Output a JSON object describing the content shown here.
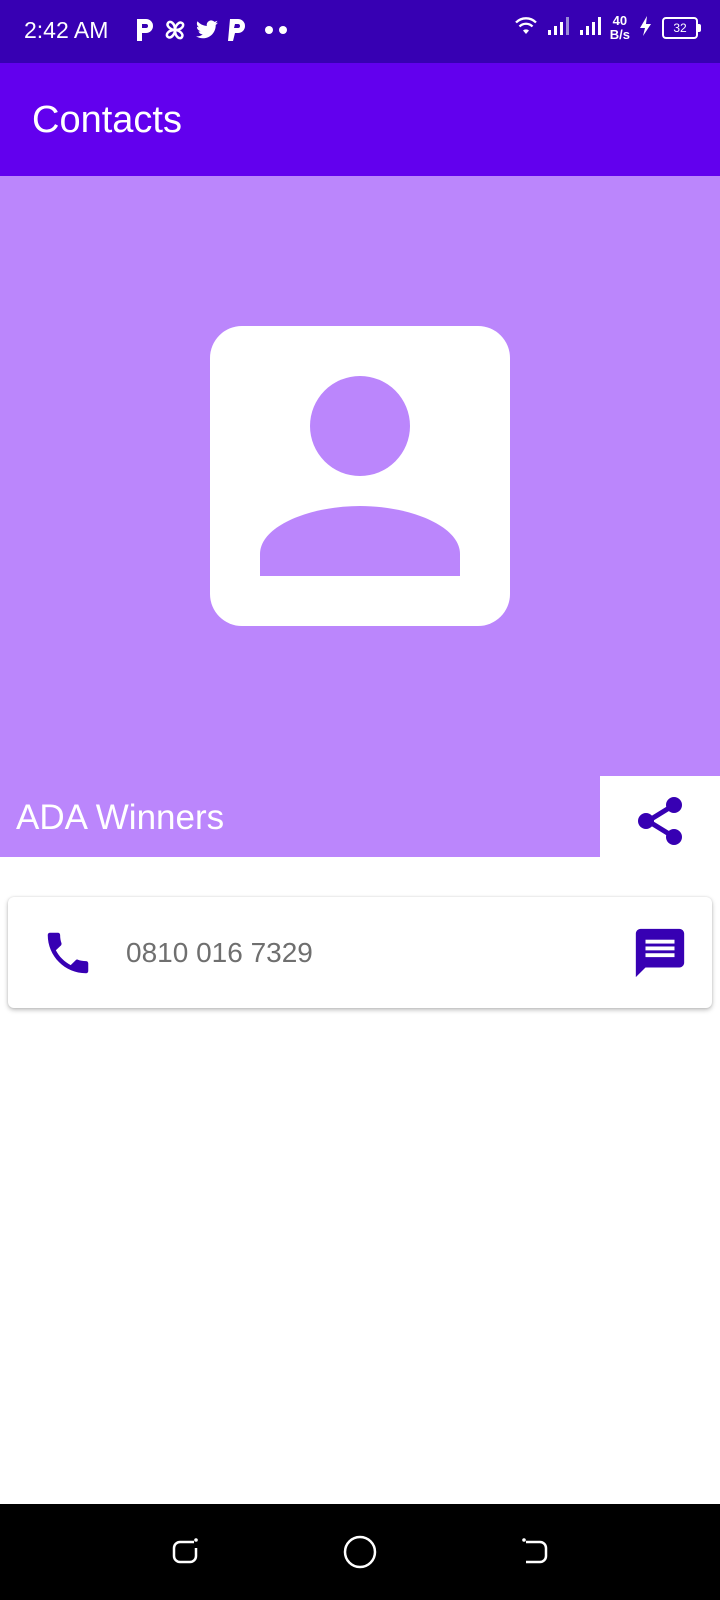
{
  "status_bar": {
    "time": "2:42 AM",
    "net_speed_value": "40",
    "net_speed_unit": "B/s",
    "battery_level": "32",
    "notification_icons": [
      "p-icon",
      "pinwheel-icon",
      "twitter-icon",
      "p-icon",
      "more-dots-icon"
    ],
    "status_icons": [
      "wifi-icon",
      "signal-icon",
      "signal-icon",
      "charging-icon",
      "battery-icon"
    ]
  },
  "app_bar": {
    "title": "Contacts"
  },
  "contact": {
    "name": "ADA Winners",
    "phone": "0810 016 7329"
  },
  "colors": {
    "status_bar": "#3700B3",
    "app_bar": "#6200EE",
    "header": "#BB86FC",
    "icon_accent": "#3700B3"
  },
  "nav": {
    "buttons": [
      "recents-icon",
      "home-icon",
      "back-icon"
    ]
  }
}
